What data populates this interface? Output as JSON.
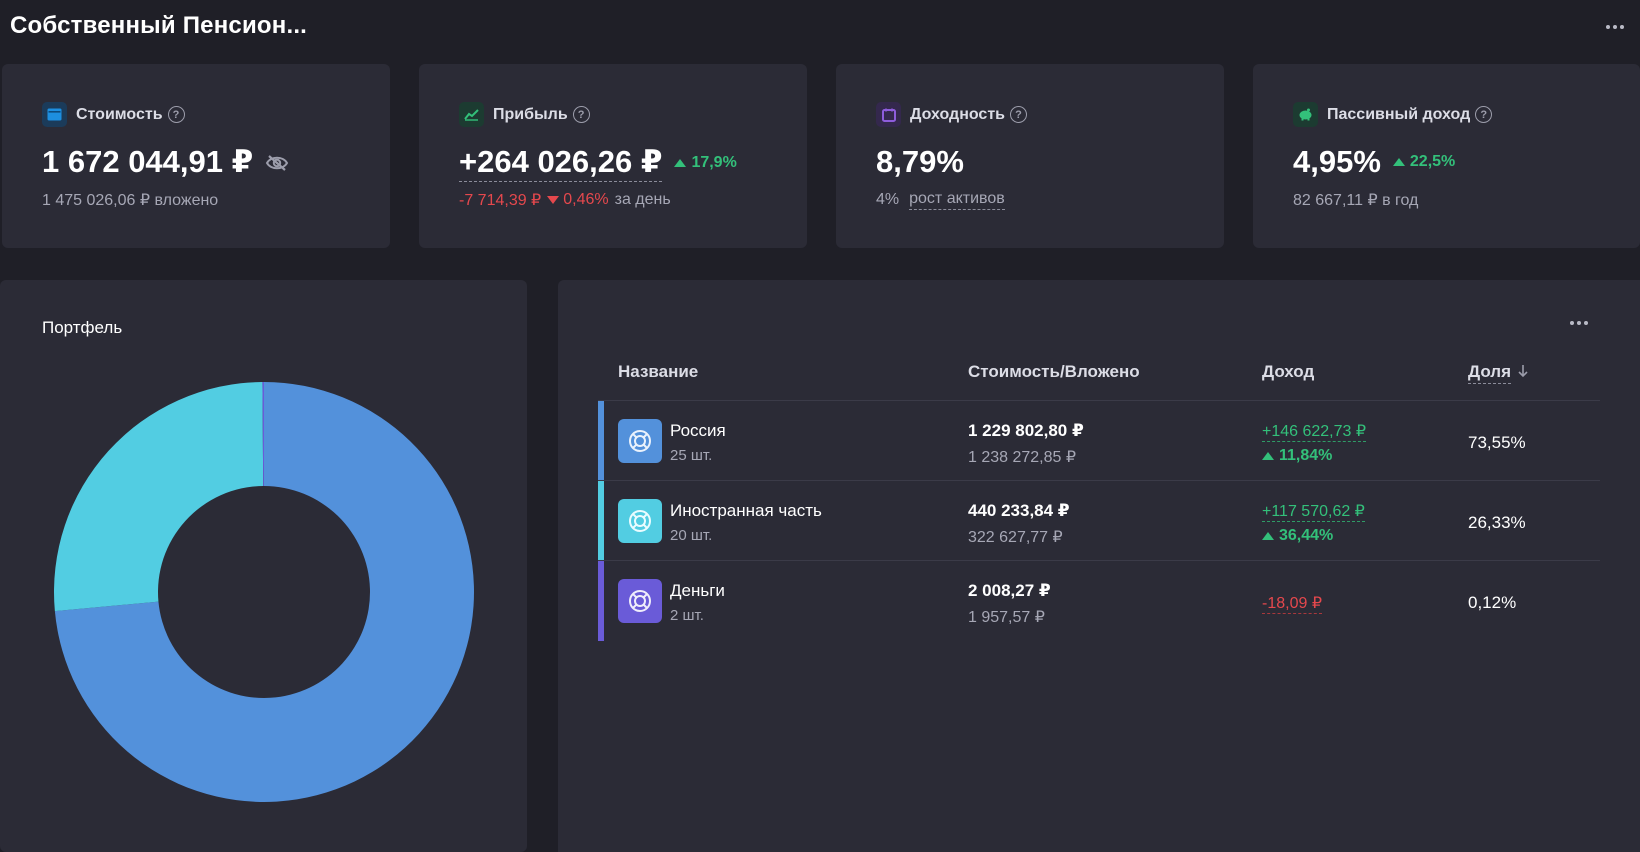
{
  "header": {
    "title": "Собственный Пенсион..."
  },
  "cards": {
    "value": {
      "label": "Стоимость",
      "main": "1 672 044,91 ₽",
      "sub": "1 475 026,06 ₽ вложено",
      "icon": "wallet-icon",
      "icon_color": "#1d8fe0"
    },
    "profit": {
      "label": "Прибыль",
      "main": "+264 026,26 ₽",
      "change_pct": "17,9%",
      "day_change": "-7 714,39 ₽",
      "day_pct": "0,46%",
      "day_suffix": "за день",
      "icon": "chart-icon",
      "icon_color": "#33c07a"
    },
    "yield": {
      "label": "Доходность",
      "main": "8,79%",
      "sub_pct": "4%",
      "sub_link": "рост активов",
      "icon": "calendar-icon",
      "icon_color": "#8e5ddc"
    },
    "passive": {
      "label": "Пассивный доход",
      "main": "4,95%",
      "change_pct": "22,5%",
      "sub": "82 667,11 ₽ в год",
      "icon": "piggy-bank-icon",
      "icon_color": "#33c07a"
    }
  },
  "portfolio": {
    "title": "Портфель"
  },
  "chart_data": {
    "type": "pie",
    "donut": true,
    "categories": [
      "Россия",
      "Иностранная часть",
      "Деньги"
    ],
    "values": [
      73.55,
      26.33,
      0.12
    ],
    "colors": [
      "#5391db",
      "#52cde2",
      "#6a5bd8"
    ]
  },
  "table": {
    "columns": {
      "name": "Название",
      "value": "Стоимость/Вложено",
      "income": "Доход",
      "share": "Доля"
    },
    "rows": [
      {
        "name": "Россия",
        "count": "25 шт.",
        "value": "1 229 802,80 ₽",
        "invested": "1 238 272,85 ₽",
        "income": "+146 622,73 ₽",
        "income_pct": "11,84%",
        "share": "73,55%",
        "color": "#5391db"
      },
      {
        "name": "Иностранная часть",
        "count": "20 шт.",
        "value": "440 233,84 ₽",
        "invested": "322 627,77 ₽",
        "income": "+117 570,62 ₽",
        "income_pct": "36,44%",
        "share": "26,33%",
        "color": "#52cde2"
      },
      {
        "name": "Деньги",
        "count": "2 шт.",
        "value": "2 008,27 ₽",
        "invested": "1 957,57 ₽",
        "income": "-18,09 ₽",
        "share": "0,12%",
        "color": "#6a5bd8"
      }
    ]
  }
}
